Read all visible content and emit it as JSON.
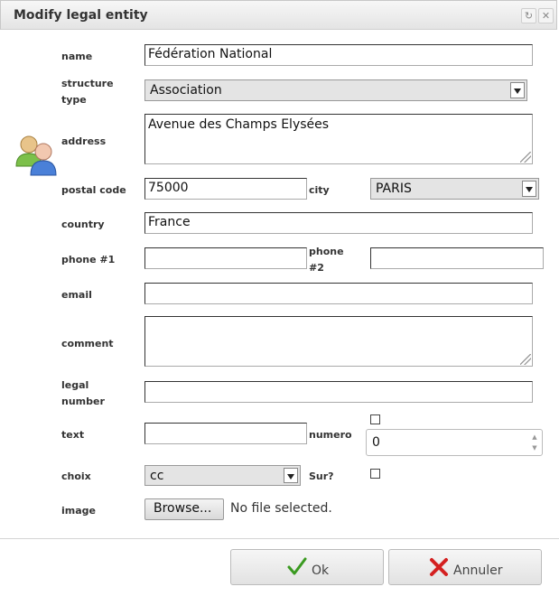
{
  "dialog": {
    "title": "Modify legal entity",
    "refresh_icon": "↻",
    "close_icon": "✕"
  },
  "form": {
    "name": {
      "label": "name",
      "value": "Fédération National"
    },
    "structure_type": {
      "label": "structure type",
      "label_line1": "structure",
      "label_line2": "type",
      "value": "Association"
    },
    "address": {
      "label": "address",
      "value": "Avenue des Champs Elysées"
    },
    "postal_code": {
      "label": "postal code",
      "value": "75000"
    },
    "city": {
      "label": "city",
      "value": "PARIS"
    },
    "country": {
      "label": "country",
      "value": "France"
    },
    "phone1": {
      "label": "phone #1",
      "value": ""
    },
    "phone2": {
      "label": "phone #2",
      "label_line1": "phone",
      "label_line2": "#2",
      "value": ""
    },
    "email": {
      "label": "email",
      "value": ""
    },
    "comment": {
      "label": "comment",
      "value": ""
    },
    "legal_number": {
      "label": "legal number",
      "label_line1": "legal",
      "label_line2": "number",
      "value": ""
    },
    "text": {
      "label": "text",
      "value": ""
    },
    "numero": {
      "label": "numero",
      "value": "0",
      "checked": false
    },
    "choix": {
      "label": "choix",
      "value": "cc"
    },
    "sur": {
      "label": "Sur?",
      "checked": false
    },
    "image": {
      "label": "image",
      "browse_label": "Browse...",
      "status": "No file selected."
    }
  },
  "buttons": {
    "ok_label": "Ok",
    "cancel_label": "Annuler"
  },
  "icons": {
    "entity": "users-group-icon",
    "ok": "checkmark-icon",
    "cancel": "cross-icon"
  },
  "colors": {
    "ok_check": "#3a9a20",
    "cancel_cross": "#d42020"
  }
}
